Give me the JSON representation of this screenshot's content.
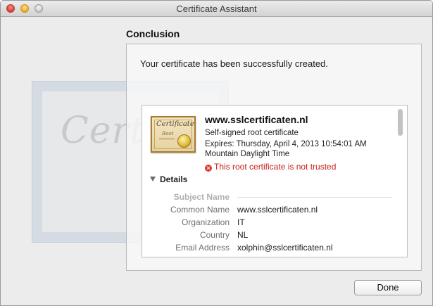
{
  "window": {
    "title": "Certificate Assistant"
  },
  "page": {
    "heading": "Conclusion",
    "message": "Your certificate has been successfully created."
  },
  "background_cert": {
    "word": "Certif"
  },
  "cert_icon": {
    "title": "Certificate",
    "subtitle": "Root"
  },
  "certificate": {
    "name": "www.sslcertificaten.nl",
    "type": "Self-signed root certificate",
    "expires": "Expires: Thursday, April 4, 2013 10:54:01 AM",
    "timezone": "Mountain Daylight Time",
    "warning": "This root certificate is not trusted",
    "warning_symbol": "✕"
  },
  "details": {
    "toggle_label": "Details",
    "section_label": "Subject Name",
    "fields": [
      {
        "label": "Common Name",
        "value": "www.sslcertificaten.nl"
      },
      {
        "label": "Organization",
        "value": "IT"
      },
      {
        "label": "Country",
        "value": "NL"
      },
      {
        "label": "Email Address",
        "value": "xolphin@sslcertificaten.nl"
      }
    ]
  },
  "buttons": {
    "done_label": "Done"
  },
  "colors": {
    "warning": "#c4211d",
    "accent_gold": "#a87b2e"
  }
}
